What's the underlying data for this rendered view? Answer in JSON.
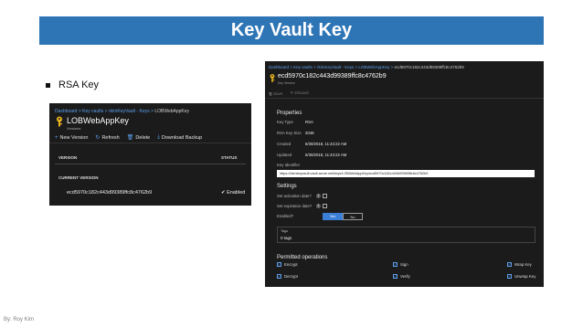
{
  "slide": {
    "title": "Key Vault Key",
    "bullet": "RSA Key",
    "footer": "By: Roy Kim"
  },
  "left_panel": {
    "breadcrumb": [
      "Dashboard",
      "Key vaults",
      "rkimKeyVault - Keys",
      "LOBWebAppKey"
    ],
    "title": "LOBWebAppKey",
    "subtitle": "Versions",
    "toolbar": [
      "New Version",
      "Refresh",
      "Delete",
      "Download Backup"
    ],
    "table_headers": {
      "version": "VERSION",
      "status": "STATUS"
    },
    "current_version_label": "CURRENT VERSION",
    "rows": [
      {
        "version": "ecd5970c182c443d99389ffc8c4762b9",
        "status": "Enabled"
      }
    ]
  },
  "right_panel": {
    "breadcrumb": [
      "Dashboard",
      "Key vaults",
      "rkimKeyVault - Keys",
      "LOBWebAppKey",
      "ecd5970c182c443d99389ffc8c4762b9"
    ],
    "title": "ecd5970c182c443d99389ffc8c4762b9",
    "subtitle": "Key Version",
    "toolbar": [
      "Save",
      "Discard"
    ],
    "properties": {
      "heading": "Properties",
      "key_type_label": "Key Type",
      "key_type": "RSA",
      "key_size_label": "RSA Key Size",
      "key_size": "2048",
      "created_label": "Created",
      "created": "6/30/2018, 11:43:22 AM",
      "updated_label": "Updated",
      "updated": "6/30/2018, 11:43:22 AM",
      "identifier_label": "Key Identifier",
      "identifier": "https://rkimkeyvault.vault.azure.net/keys/LOBWebAppKey/ecd5970c182c443d99389ffc8c4762b9"
    },
    "settings": {
      "heading": "Settings",
      "activation_label": "Set activation date?",
      "expiration_label": "Set expiration date?",
      "enabled_label": "Enabled?",
      "yes": "Yes",
      "no": "No"
    },
    "tags": {
      "label": "Tags",
      "value": "0 tags"
    },
    "permitted": {
      "heading": "Permitted operations",
      "ops": [
        "Encrypt",
        "Sign",
        "Wrap Key",
        "Decrypt",
        "Verify",
        "Unwrap Key"
      ]
    }
  }
}
